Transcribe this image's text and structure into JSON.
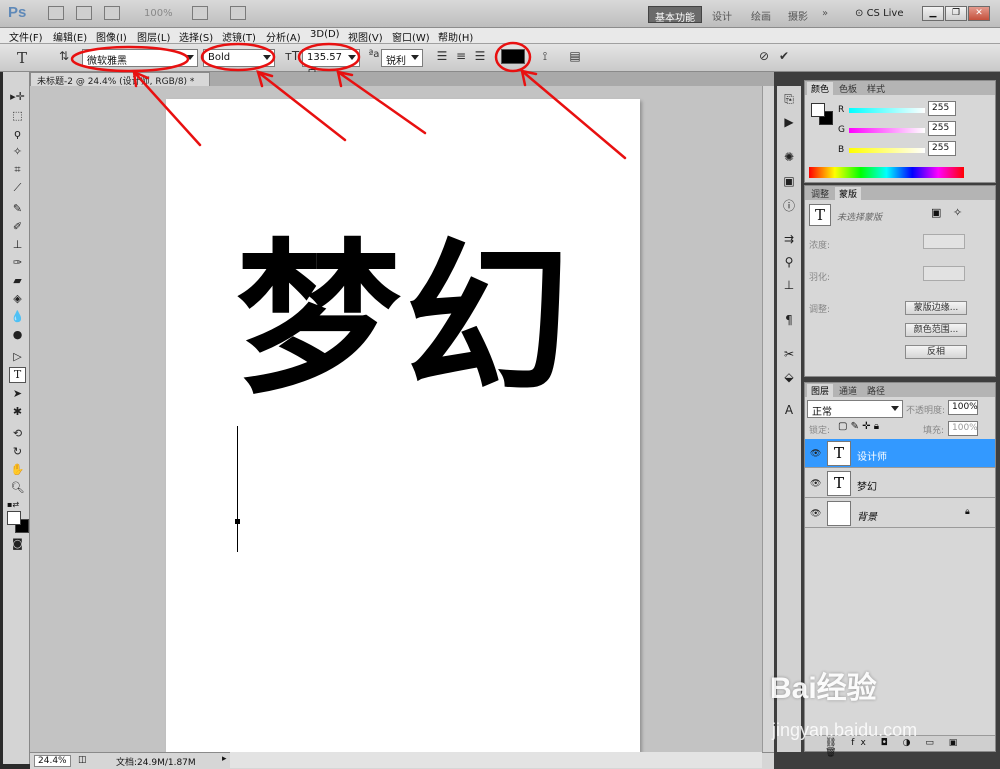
{
  "app": {
    "logo": "Ps",
    "zoom_menu": "100%"
  },
  "workspaces": {
    "active": "基本功能",
    "items": [
      "设计",
      "绘画",
      "摄影"
    ],
    "more": "»",
    "cslive": "CS Live"
  },
  "menu": [
    "文件(F)",
    "编辑(E)",
    "图像(I)",
    "图层(L)",
    "选择(S)",
    "滤镜(T)",
    "分析(A)",
    "3D(D)",
    "视图(V)",
    "窗口(W)",
    "帮助(H)"
  ],
  "options": {
    "font_family": "微软雅黑",
    "font_style": "Bold",
    "font_size": "135.57 点",
    "antialias": "锐利",
    "color": "#000000"
  },
  "document": {
    "tab_title": "未标题-2 @ 24.4% (设计师, RGB/8) *",
    "canvas_text": "梦幻",
    "zoom": "24.4%",
    "doc_info": "文档:24.9M/1.87M"
  },
  "color_panel": {
    "tabs": [
      "颜色",
      "色板",
      "样式"
    ],
    "r_label": "R",
    "g_label": "G",
    "b_label": "B",
    "r": "255",
    "g": "255",
    "b": "255"
  },
  "masks_panel": {
    "tabs": [
      "调整",
      "蒙版"
    ],
    "no_mask": "未选择蒙版",
    "density": "浓度:",
    "feather": "羽化:",
    "refine": "调整:",
    "btn_edge": "蒙版边缘...",
    "btn_range": "颜色范围...",
    "btn_invert": "反相"
  },
  "layers_panel": {
    "tabs": [
      "图层",
      "通道",
      "路径"
    ],
    "blend": "正常",
    "opacity_label": "不透明度:",
    "opacity": "100%",
    "lock_label": "锁定:",
    "fill_label": "填充:",
    "fill": "100%",
    "layers": [
      {
        "name": "设计师",
        "type": "T",
        "selected": true
      },
      {
        "name": "梦幻",
        "type": "T",
        "selected": false
      },
      {
        "name": "背景",
        "type": "bg",
        "selected": false
      }
    ]
  },
  "watermark": {
    "brand": "Bai经验",
    "url": "jingyan.baidu.com"
  },
  "annotation_color": "#e81010"
}
